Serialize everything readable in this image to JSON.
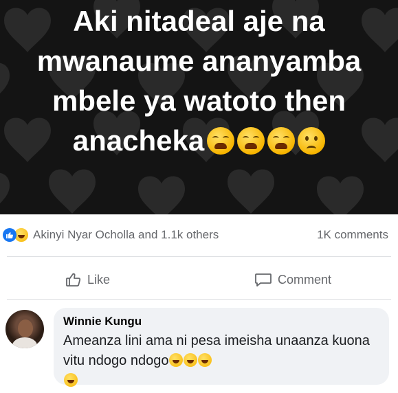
{
  "post": {
    "image_text_lines": [
      "Aki nitadeal aje na",
      "mwanaume ananyamba",
      "mbele ya watoto then",
      "anacheka"
    ],
    "image_emojis": [
      "weary-face",
      "weary-face",
      "weary-face",
      "frowning-face"
    ]
  },
  "reactions": {
    "icons": [
      "like-icon",
      "haha-icon"
    ],
    "summary": "Akinyi Nyar Ocholla and 1.1k others",
    "comments_count": "1K comments"
  },
  "actions": {
    "like_label": "Like",
    "comment_label": "Comment"
  },
  "comment": {
    "author": "Winnie Kungu",
    "text": "Ameanza lini ama ni pesa imeisha unaanza kuona vitu ndogo ndogo",
    "emojis": [
      "laughing-face",
      "laughing-face",
      "laughing-face",
      "laughing-face"
    ]
  },
  "colors": {
    "like_blue": "#1877f2",
    "bubble_bg": "#f0f2f5",
    "secondary_text": "#65676b",
    "image_bg": "#141414"
  }
}
